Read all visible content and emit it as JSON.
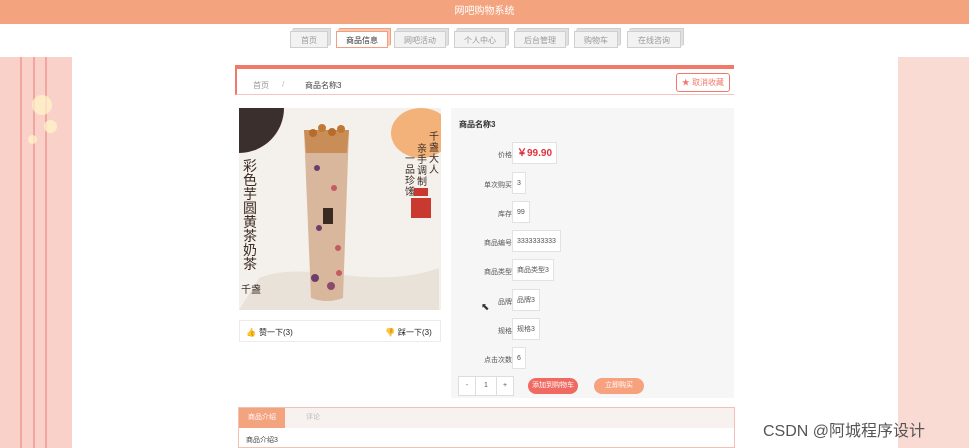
{
  "header": {
    "title": "网吧购物系统"
  },
  "nav": {
    "tabs": [
      {
        "label": "首页",
        "active": false
      },
      {
        "label": "商品信息",
        "active": true
      },
      {
        "label": "网吧活动",
        "active": false
      },
      {
        "label": "个人中心",
        "active": false
      },
      {
        "label": "后台管理",
        "active": false
      },
      {
        "label": "购物车",
        "active": false
      },
      {
        "label": "在线咨询",
        "active": false
      }
    ]
  },
  "breadcrumb": {
    "home": "首页",
    "separator": "/",
    "current": "商品名称3"
  },
  "favorite": {
    "label": "取消收藏",
    "icon": "star-icon"
  },
  "product_image": {
    "text_left": "彩色芋圆黄茶奶茶",
    "text_right_1": "千盏大人",
    "text_right_2": "亲手调制",
    "text_right_3": "一品珍馐",
    "brand": "千盏"
  },
  "votes": {
    "like_label": "赞一下(3)",
    "dislike_label": "踩一下(3)"
  },
  "product": {
    "name": "商品名称3",
    "fields": [
      {
        "label": "价格:",
        "value": "￥99.90"
      },
      {
        "label": "单次购买:",
        "value": "3"
      },
      {
        "label": "库存:",
        "value": "99"
      },
      {
        "label": "商品编号:",
        "value": "3333333333"
      },
      {
        "label": "商品类型:",
        "value": "商品类型3"
      },
      {
        "label": "品牌:",
        "value": "品牌3"
      },
      {
        "label": "规格:",
        "value": "规格3"
      },
      {
        "label": "点击次数:",
        "value": "6"
      }
    ],
    "quantity": "1",
    "add_cart_label": "添加到购物车",
    "buy_label": "立即购买"
  },
  "detail": {
    "tabs": [
      {
        "label": "商品介绍",
        "active": true
      },
      {
        "label": "评论",
        "active": false
      }
    ],
    "content": "商品介绍3"
  },
  "watermark": "CSDN @阿城程序设计",
  "colors": {
    "header": "#f4a37f",
    "accent": "#f0796a",
    "price": "#e0313b",
    "side": "#f9d1c8"
  }
}
